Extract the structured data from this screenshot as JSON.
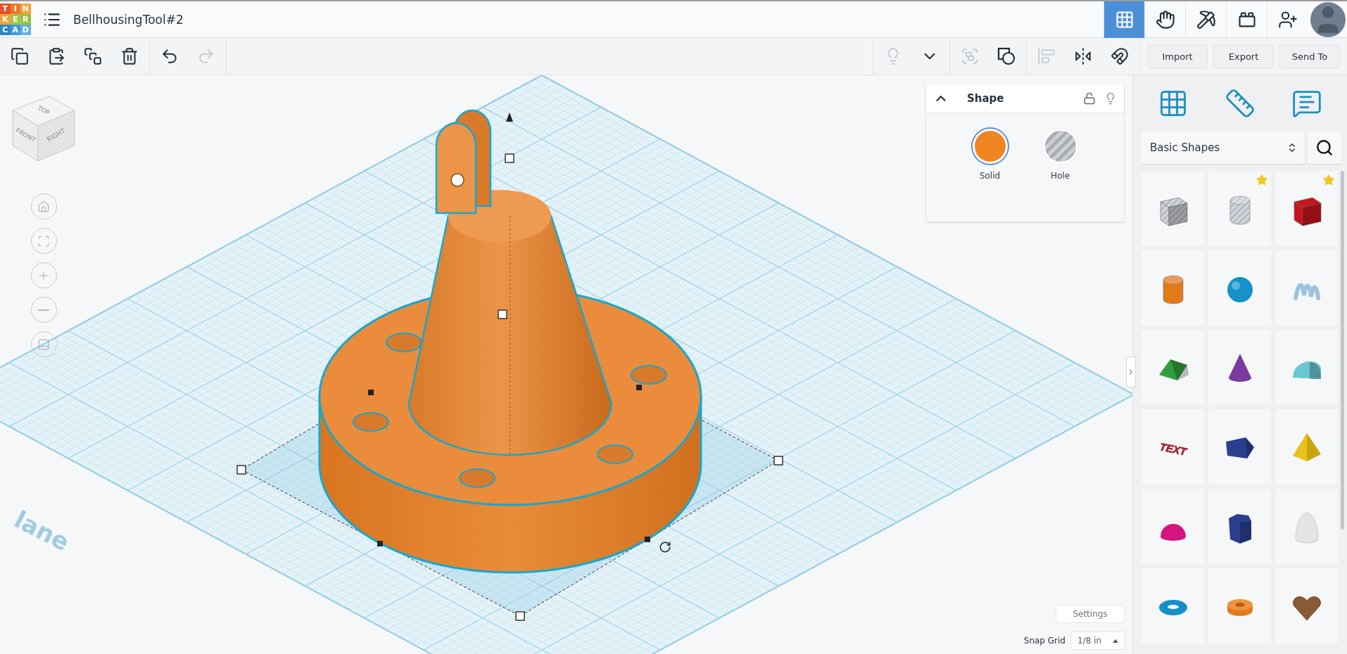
{
  "logo": {
    "letters": [
      {
        "char": "T",
        "color": "#e2522a"
      },
      {
        "char": "I",
        "color": "#ea7a2b"
      },
      {
        "char": "N",
        "color": "#f2a33a"
      },
      {
        "char": "K",
        "color": "#f2a33a"
      },
      {
        "char": "E",
        "color": "#a6c544"
      },
      {
        "char": "R",
        "color": "#94c340"
      },
      {
        "char": "C",
        "color": "#2d86c6"
      },
      {
        "char": "A",
        "color": "#3d9ad3"
      },
      {
        "char": "D",
        "color": "#64b3de"
      }
    ]
  },
  "title": "BellhousingTool#2",
  "top_nav": [
    {
      "kind": "grid",
      "selected": true
    },
    {
      "kind": "hand",
      "selected": false
    },
    {
      "kind": "pickaxe",
      "selected": false
    },
    {
      "kind": "brick",
      "selected": false
    },
    {
      "kind": "add-user",
      "selected": false
    }
  ],
  "toolbar": {
    "left_groups": [
      [
        {
          "kind": "copy",
          "disabled": false
        },
        {
          "kind": "paste",
          "disabled": false
        },
        {
          "kind": "duplicate",
          "disabled": false
        },
        {
          "kind": "delete",
          "disabled": false
        }
      ],
      [
        {
          "kind": "undo",
          "disabled": false
        },
        {
          "kind": "redo",
          "disabled": true
        }
      ]
    ],
    "right_groups": [
      [
        {
          "kind": "light",
          "disabled": true
        },
        {
          "kind": "caret",
          "disabled": false
        }
      ],
      [
        {
          "kind": "group",
          "disabled": true
        },
        {
          "kind": "ungroup",
          "disabled": false
        }
      ],
      [
        {
          "kind": "align",
          "disabled": true
        },
        {
          "kind": "mirror",
          "disabled": false
        },
        {
          "kind": "cruise",
          "disabled": false
        }
      ]
    ],
    "actions": [
      "Import",
      "Export",
      "Send To"
    ]
  },
  "view_cube": {
    "top": "TOP",
    "front": "FRONT",
    "right": "RIGHT"
  },
  "view_controls": [
    {
      "kind": "home"
    },
    {
      "kind": "fit"
    },
    {
      "kind": "zoom-in"
    },
    {
      "kind": "zoom-out"
    },
    {
      "kind": "ortho"
    }
  ],
  "workplane_label": "lane",
  "inspector": {
    "title": "Shape",
    "expanded": true,
    "locked": false,
    "options": [
      {
        "label": "Solid",
        "kind": "solid",
        "selected": true
      },
      {
        "label": "Hole",
        "kind": "hole",
        "selected": false
      }
    ]
  },
  "settings": "Settings",
  "snap_grid": {
    "label": "Snap Grid",
    "value": "1/8 in"
  },
  "panel_tabs": [
    {
      "kind": "workplane"
    },
    {
      "kind": "ruler"
    },
    {
      "kind": "notes"
    }
  ],
  "library": {
    "category": "Basic Shapes",
    "shapes": [
      {
        "kind": "hole-box",
        "color": "#b8bcc4",
        "starred": false
      },
      {
        "kind": "hole-cylinder",
        "color": "#b8bcc4",
        "starred": true
      },
      {
        "kind": "box",
        "color": "#c8151d",
        "starred": true
      },
      {
        "kind": "cylinder",
        "color": "#e27a1c",
        "starred": false
      },
      {
        "kind": "sphere",
        "color": "#1492c9",
        "starred": false
      },
      {
        "kind": "scribble",
        "color": "#9cc3df",
        "starred": false
      },
      {
        "kind": "roof",
        "color": "#2f9f3b",
        "starred": false
      },
      {
        "kind": "cone",
        "color": "#7a3a9e",
        "starred": false
      },
      {
        "kind": "round-roof",
        "color": "#6ac6d2",
        "starred": false
      },
      {
        "kind": "text",
        "color": "#c4232b",
        "starred": false,
        "label": "TEXT"
      },
      {
        "kind": "prism",
        "color": "#2b3f8e",
        "starred": false
      },
      {
        "kind": "pyramid",
        "color": "#e8c21a",
        "starred": false
      },
      {
        "kind": "half-sphere",
        "color": "#d5157f",
        "starred": false
      },
      {
        "kind": "hexagon",
        "color": "#2b3f8e",
        "starred": false
      },
      {
        "kind": "paraboloid",
        "color": "#e4e4e4",
        "starred": false
      },
      {
        "kind": "torus",
        "color": "#168fc7",
        "starred": false
      },
      {
        "kind": "tube",
        "color": "#e27a1c",
        "starred": false
      },
      {
        "kind": "heart",
        "color": "#8a5a34",
        "starred": false
      }
    ]
  }
}
